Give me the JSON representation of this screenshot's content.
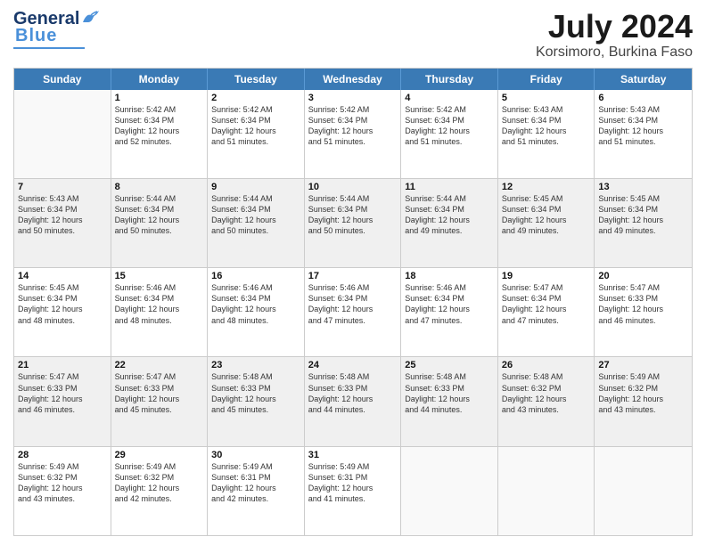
{
  "header": {
    "logo_general": "General",
    "logo_blue": "Blue",
    "logo_underline": "___",
    "month_year": "July 2024",
    "location": "Korsimoro, Burkina Faso"
  },
  "calendar": {
    "days_of_week": [
      "Sunday",
      "Monday",
      "Tuesday",
      "Wednesday",
      "Thursday",
      "Friday",
      "Saturday"
    ],
    "rows": [
      [
        {
          "day": "",
          "lines": []
        },
        {
          "day": "1",
          "lines": [
            "Sunrise: 5:42 AM",
            "Sunset: 6:34 PM",
            "Daylight: 12 hours",
            "and 52 minutes."
          ]
        },
        {
          "day": "2",
          "lines": [
            "Sunrise: 5:42 AM",
            "Sunset: 6:34 PM",
            "Daylight: 12 hours",
            "and 51 minutes."
          ]
        },
        {
          "day": "3",
          "lines": [
            "Sunrise: 5:42 AM",
            "Sunset: 6:34 PM",
            "Daylight: 12 hours",
            "and 51 minutes."
          ]
        },
        {
          "day": "4",
          "lines": [
            "Sunrise: 5:42 AM",
            "Sunset: 6:34 PM",
            "Daylight: 12 hours",
            "and 51 minutes."
          ]
        },
        {
          "day": "5",
          "lines": [
            "Sunrise: 5:43 AM",
            "Sunset: 6:34 PM",
            "Daylight: 12 hours",
            "and 51 minutes."
          ]
        },
        {
          "day": "6",
          "lines": [
            "Sunrise: 5:43 AM",
            "Sunset: 6:34 PM",
            "Daylight: 12 hours",
            "and 51 minutes."
          ]
        }
      ],
      [
        {
          "day": "7",
          "lines": [
            "Sunrise: 5:43 AM",
            "Sunset: 6:34 PM",
            "Daylight: 12 hours",
            "and 50 minutes."
          ]
        },
        {
          "day": "8",
          "lines": [
            "Sunrise: 5:44 AM",
            "Sunset: 6:34 PM",
            "Daylight: 12 hours",
            "and 50 minutes."
          ]
        },
        {
          "day": "9",
          "lines": [
            "Sunrise: 5:44 AM",
            "Sunset: 6:34 PM",
            "Daylight: 12 hours",
            "and 50 minutes."
          ]
        },
        {
          "day": "10",
          "lines": [
            "Sunrise: 5:44 AM",
            "Sunset: 6:34 PM",
            "Daylight: 12 hours",
            "and 50 minutes."
          ]
        },
        {
          "day": "11",
          "lines": [
            "Sunrise: 5:44 AM",
            "Sunset: 6:34 PM",
            "Daylight: 12 hours",
            "and 49 minutes."
          ]
        },
        {
          "day": "12",
          "lines": [
            "Sunrise: 5:45 AM",
            "Sunset: 6:34 PM",
            "Daylight: 12 hours",
            "and 49 minutes."
          ]
        },
        {
          "day": "13",
          "lines": [
            "Sunrise: 5:45 AM",
            "Sunset: 6:34 PM",
            "Daylight: 12 hours",
            "and 49 minutes."
          ]
        }
      ],
      [
        {
          "day": "14",
          "lines": [
            "Sunrise: 5:45 AM",
            "Sunset: 6:34 PM",
            "Daylight: 12 hours",
            "and 48 minutes."
          ]
        },
        {
          "day": "15",
          "lines": [
            "Sunrise: 5:46 AM",
            "Sunset: 6:34 PM",
            "Daylight: 12 hours",
            "and 48 minutes."
          ]
        },
        {
          "day": "16",
          "lines": [
            "Sunrise: 5:46 AM",
            "Sunset: 6:34 PM",
            "Daylight: 12 hours",
            "and 48 minutes."
          ]
        },
        {
          "day": "17",
          "lines": [
            "Sunrise: 5:46 AM",
            "Sunset: 6:34 PM",
            "Daylight: 12 hours",
            "and 47 minutes."
          ]
        },
        {
          "day": "18",
          "lines": [
            "Sunrise: 5:46 AM",
            "Sunset: 6:34 PM",
            "Daylight: 12 hours",
            "and 47 minutes."
          ]
        },
        {
          "day": "19",
          "lines": [
            "Sunrise: 5:47 AM",
            "Sunset: 6:34 PM",
            "Daylight: 12 hours",
            "and 47 minutes."
          ]
        },
        {
          "day": "20",
          "lines": [
            "Sunrise: 5:47 AM",
            "Sunset: 6:33 PM",
            "Daylight: 12 hours",
            "and 46 minutes."
          ]
        }
      ],
      [
        {
          "day": "21",
          "lines": [
            "Sunrise: 5:47 AM",
            "Sunset: 6:33 PM",
            "Daylight: 12 hours",
            "and 46 minutes."
          ]
        },
        {
          "day": "22",
          "lines": [
            "Sunrise: 5:47 AM",
            "Sunset: 6:33 PM",
            "Daylight: 12 hours",
            "and 45 minutes."
          ]
        },
        {
          "day": "23",
          "lines": [
            "Sunrise: 5:48 AM",
            "Sunset: 6:33 PM",
            "Daylight: 12 hours",
            "and 45 minutes."
          ]
        },
        {
          "day": "24",
          "lines": [
            "Sunrise: 5:48 AM",
            "Sunset: 6:33 PM",
            "Daylight: 12 hours",
            "and 44 minutes."
          ]
        },
        {
          "day": "25",
          "lines": [
            "Sunrise: 5:48 AM",
            "Sunset: 6:33 PM",
            "Daylight: 12 hours",
            "and 44 minutes."
          ]
        },
        {
          "day": "26",
          "lines": [
            "Sunrise: 5:48 AM",
            "Sunset: 6:32 PM",
            "Daylight: 12 hours",
            "and 43 minutes."
          ]
        },
        {
          "day": "27",
          "lines": [
            "Sunrise: 5:49 AM",
            "Sunset: 6:32 PM",
            "Daylight: 12 hours",
            "and 43 minutes."
          ]
        }
      ],
      [
        {
          "day": "28",
          "lines": [
            "Sunrise: 5:49 AM",
            "Sunset: 6:32 PM",
            "Daylight: 12 hours",
            "and 43 minutes."
          ]
        },
        {
          "day": "29",
          "lines": [
            "Sunrise: 5:49 AM",
            "Sunset: 6:32 PM",
            "Daylight: 12 hours",
            "and 42 minutes."
          ]
        },
        {
          "day": "30",
          "lines": [
            "Sunrise: 5:49 AM",
            "Sunset: 6:31 PM",
            "Daylight: 12 hours",
            "and 42 minutes."
          ]
        },
        {
          "day": "31",
          "lines": [
            "Sunrise: 5:49 AM",
            "Sunset: 6:31 PM",
            "Daylight: 12 hours",
            "and 41 minutes."
          ]
        },
        {
          "day": "",
          "lines": []
        },
        {
          "day": "",
          "lines": []
        },
        {
          "day": "",
          "lines": []
        }
      ]
    ]
  }
}
